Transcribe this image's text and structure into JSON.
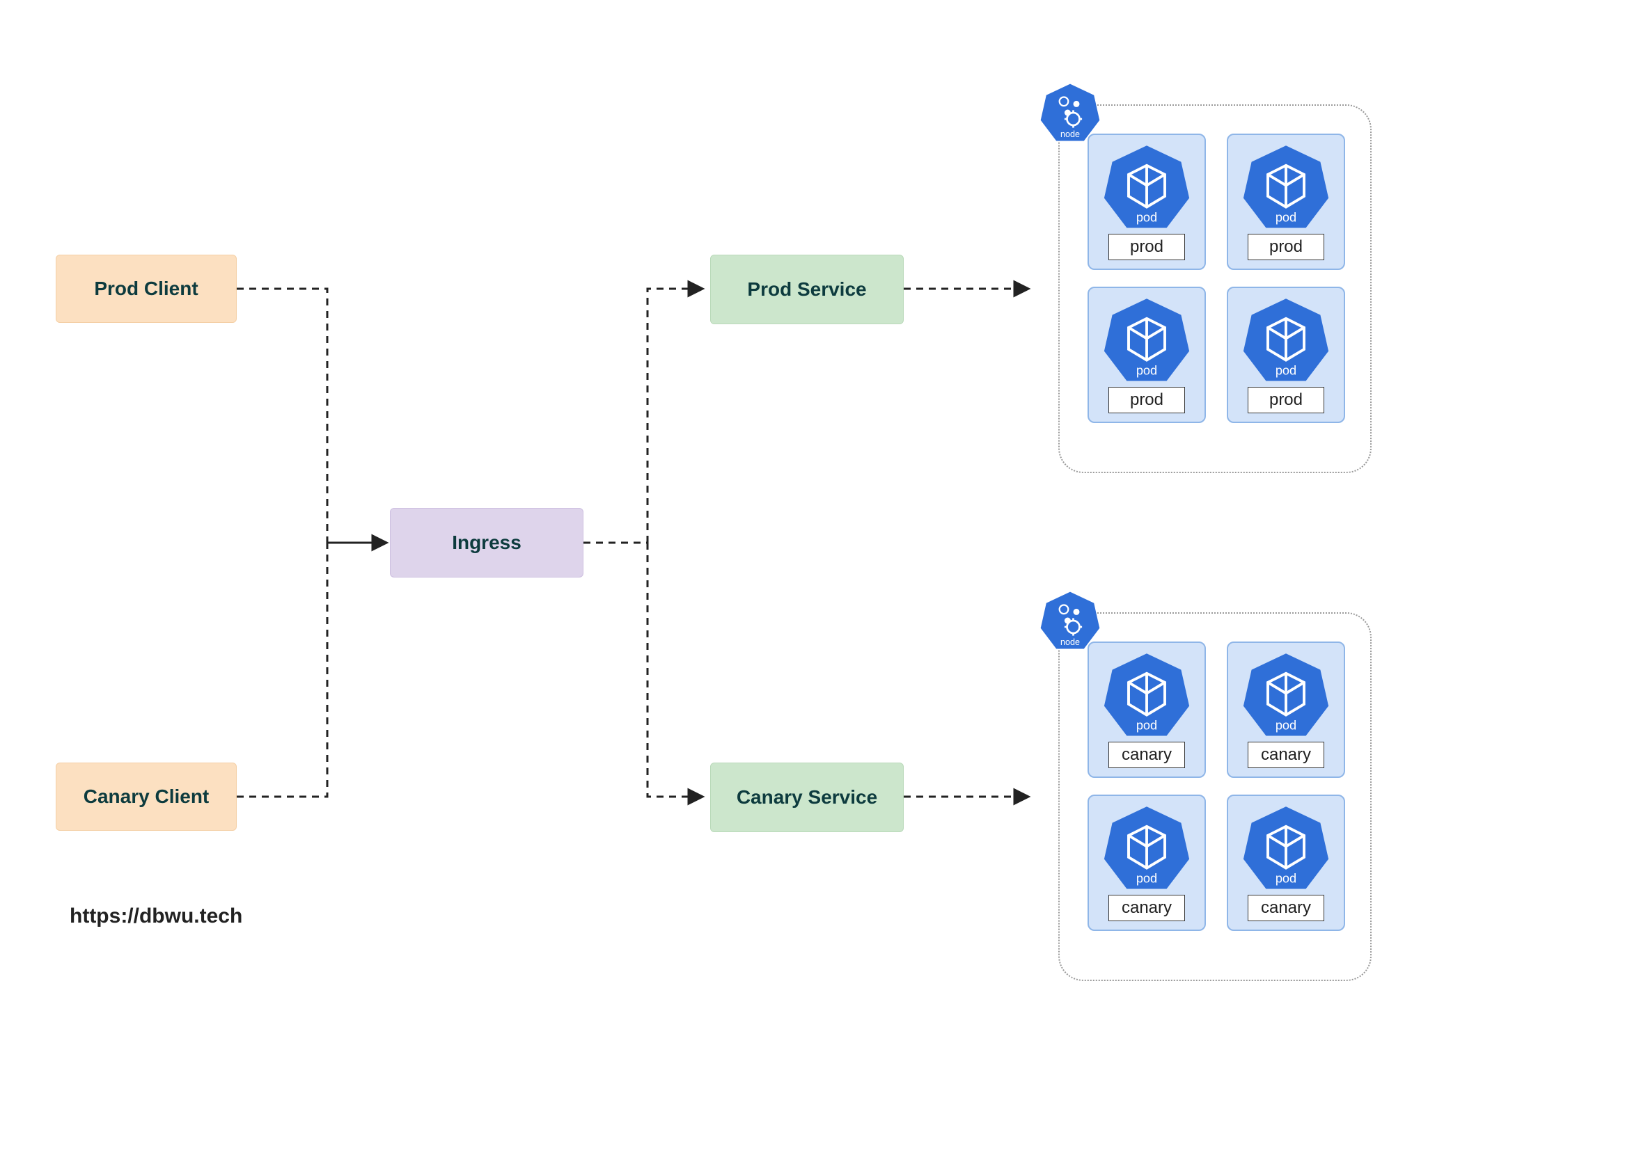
{
  "clients": {
    "prod": "Prod Client",
    "canary": "Canary Client"
  },
  "ingress": {
    "label": "Ingress"
  },
  "services": {
    "prod": "Prod Service",
    "canary": "Canary Service"
  },
  "node_badge": "node",
  "pod_badge": "pod",
  "pods": {
    "prod": [
      "prod",
      "prod",
      "prod",
      "prod"
    ],
    "canary": [
      "canary",
      "canary",
      "canary",
      "canary"
    ]
  },
  "credit": "https://dbwu.tech",
  "colors": {
    "client_bg": "#fce0c1",
    "ingress_bg": "#ded4eb",
    "service_bg": "#cce6cc",
    "pod_bg": "#d3e3f9",
    "k8s_blue": "#2f6fd8"
  }
}
